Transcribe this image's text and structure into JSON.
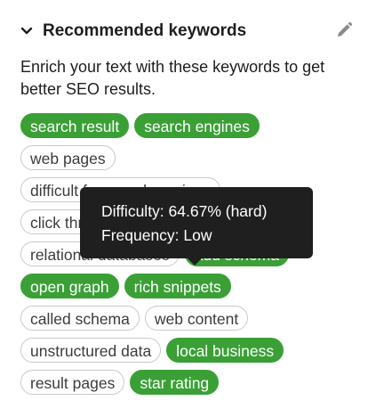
{
  "header": {
    "title": "Recommended keywords",
    "toggle_icon": "chevron-down-icon",
    "edit_icon": "pencil-icon"
  },
  "description": "Enrich your text with these keywords to get better SEO results.",
  "colors": {
    "used_chip": "#3aa036",
    "unused_border": "#c9c9c9",
    "tooltip_bg": "#1f1f1f"
  },
  "keywords": [
    {
      "label": "search result",
      "used": true
    },
    {
      "label": "search engines",
      "used": true
    },
    {
      "label": "web pages",
      "used": false
    },
    {
      "label": "difficult for search engines",
      "used": false
    },
    {
      "label": "click through",
      "used": false
    },
    {
      "label": "relational databases",
      "used": false
    },
    {
      "label": "add schema",
      "used": true
    },
    {
      "label": "open graph",
      "used": true
    },
    {
      "label": "rich snippets",
      "used": true
    },
    {
      "label": "called schema",
      "used": false
    },
    {
      "label": "web content",
      "used": false
    },
    {
      "label": "unstructured data",
      "used": false
    },
    {
      "label": "local business",
      "used": true
    },
    {
      "label": "result pages",
      "used": false
    },
    {
      "label": "star rating",
      "used": true
    }
  ],
  "tooltip": {
    "difficulty": "Difficulty: 64.67% (hard)",
    "frequency": "Frequency: Low"
  }
}
